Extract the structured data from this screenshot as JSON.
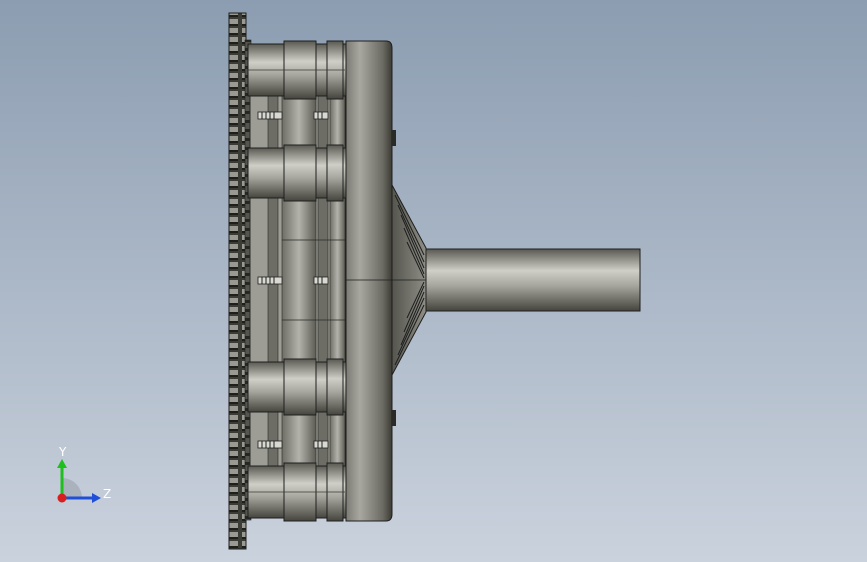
{
  "viewport": {
    "background_top": "#8c9db1",
    "background_bottom": "#cad2dd"
  },
  "model": {
    "metal_dark": "#3f3f38",
    "metal_mid": "#8c8c84",
    "metal_light": "#c9c9c2",
    "edge_color": "#1e1e1e"
  },
  "triad": {
    "y_label": "Y",
    "z_label": "Z",
    "y_color": "#1fbf1f",
    "z_color": "#1f4fd8",
    "x_color": "#d81f1f"
  }
}
